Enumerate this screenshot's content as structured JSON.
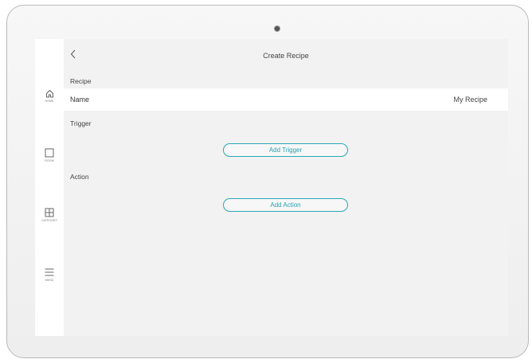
{
  "header": {
    "title": "Create Recipe"
  },
  "sidebar": {
    "items": [
      {
        "label": "HOME",
        "icon": "home-icon"
      },
      {
        "label": "ROOM",
        "icon": "room-icon"
      },
      {
        "label": "CATEGORY",
        "icon": "category-icon"
      },
      {
        "label": "MENU",
        "icon": "menu-icon"
      }
    ]
  },
  "recipe": {
    "section_label": "Recipe",
    "name_label": "Name",
    "name_value": "My Recipe"
  },
  "trigger": {
    "section_label": "Trigger",
    "button_label": "Add Trigger"
  },
  "action": {
    "section_label": "Action",
    "button_label": "Add Action"
  },
  "colors": {
    "accent": "#2aa7b6",
    "screen_bg": "#f2f2f2",
    "sidebar_bg": "#ffffff"
  }
}
